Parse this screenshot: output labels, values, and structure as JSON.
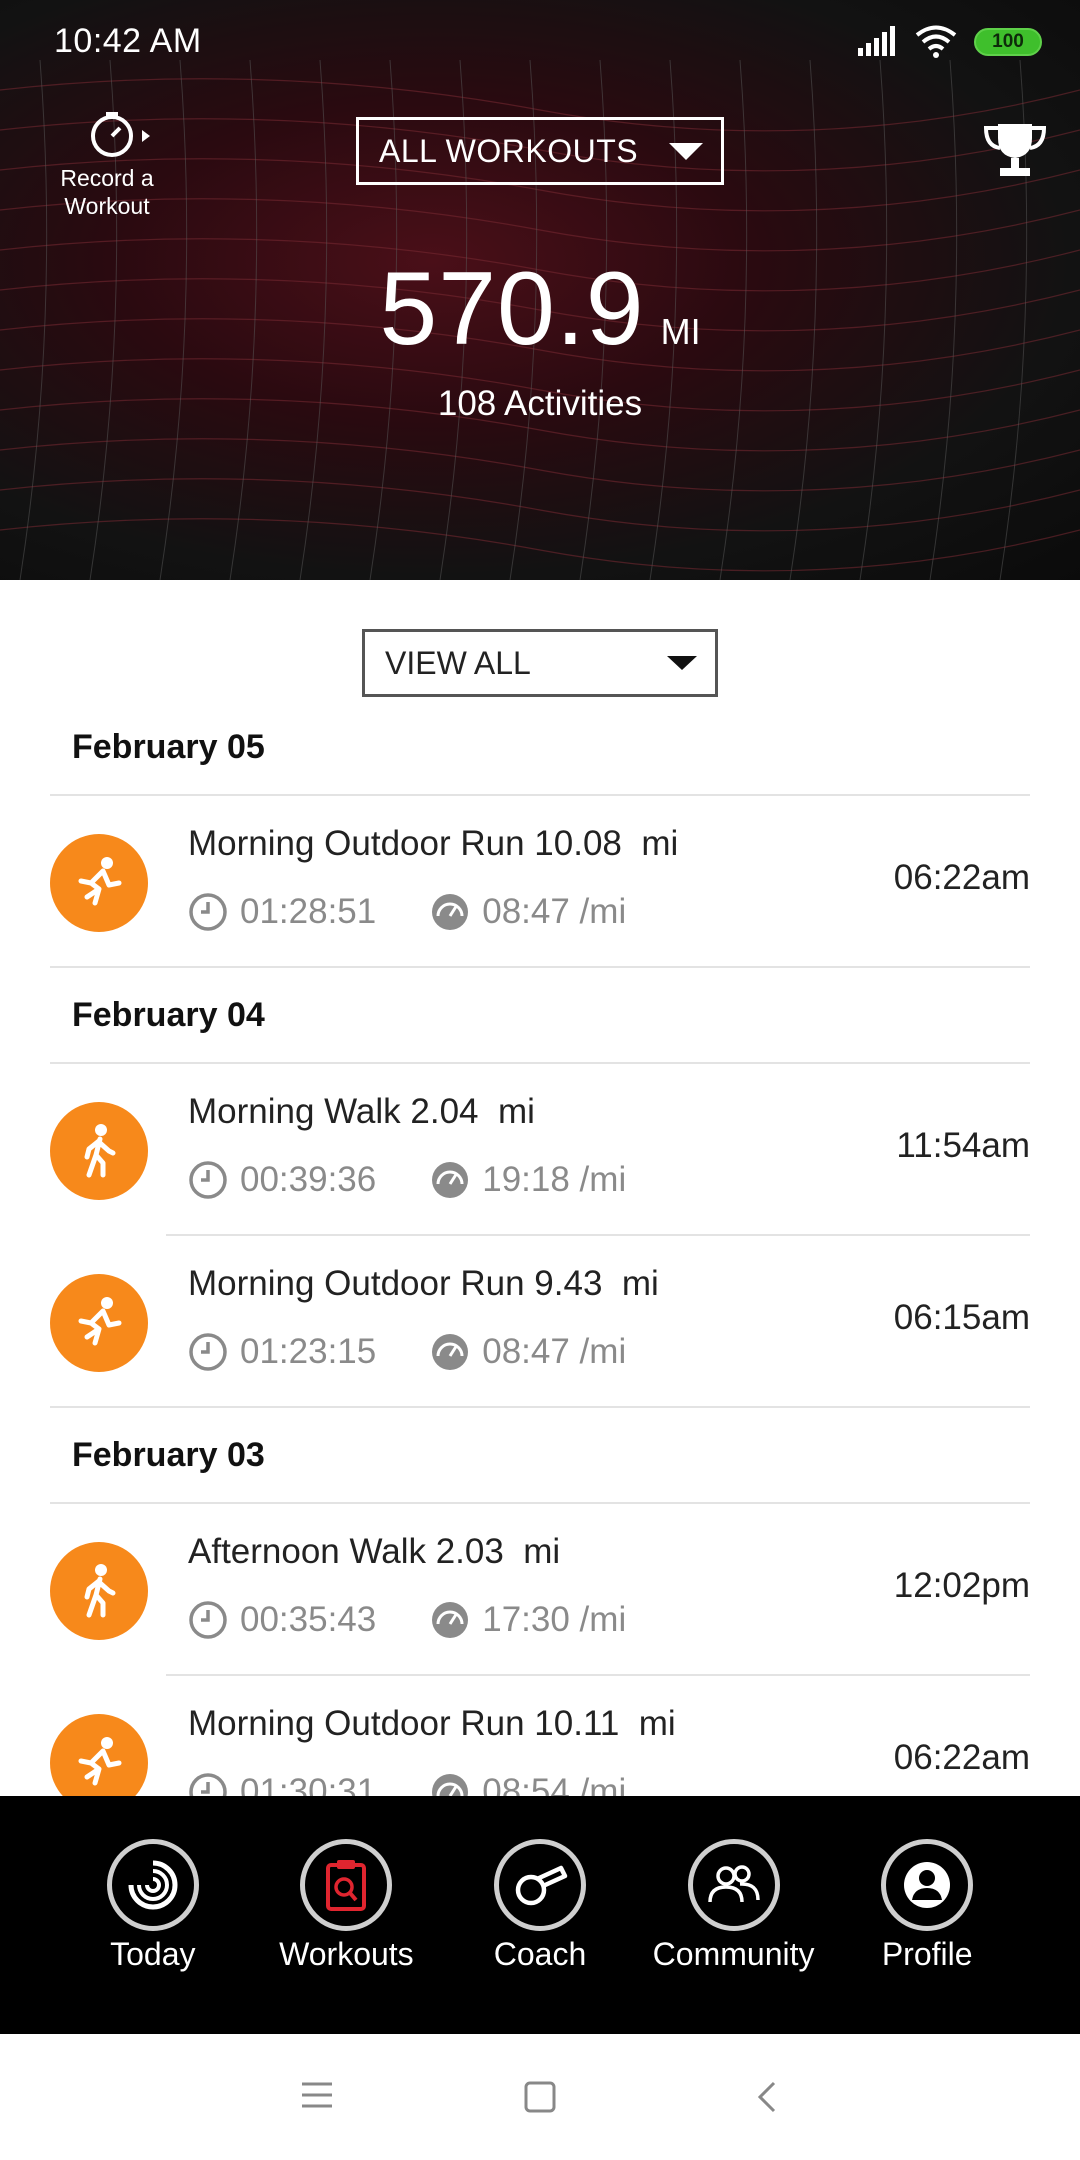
{
  "status_bar": {
    "time": "10:42 AM",
    "battery": "100"
  },
  "header": {
    "record_label_line1": "Record a",
    "record_label_line2": "Workout",
    "filter_label": "ALL WORKOUTS",
    "total_distance": "570.9",
    "total_unit": "MI",
    "activities": "108 Activities"
  },
  "list": {
    "view_filter": "VIEW ALL",
    "days": [
      {
        "date": "February 05",
        "workouts": [
          {
            "title": "Morning Outdoor Run 10.08  mi",
            "duration": "01:28:51",
            "pace": "08:47 /mi",
            "time": "06:22am",
            "icon": "run-icon"
          }
        ]
      },
      {
        "date": "February 04",
        "workouts": [
          {
            "title": "Morning Walk 2.04  mi",
            "duration": "00:39:36",
            "pace": "19:18 /mi",
            "time": "11:54am",
            "icon": "walk-icon"
          },
          {
            "title": "Morning Outdoor Run 9.43  mi",
            "duration": "01:23:15",
            "pace": "08:47 /mi",
            "time": "06:15am",
            "icon": "run-icon"
          }
        ]
      },
      {
        "date": "February 03",
        "workouts": [
          {
            "title": "Afternoon Walk 2.03  mi",
            "duration": "00:35:43",
            "pace": "17:30 /mi",
            "time": "12:02pm",
            "icon": "walk-icon"
          },
          {
            "title": "Morning Outdoor Run 10.11  mi",
            "duration": "01:30:31",
            "pace": "08:54 /mi",
            "time": "06:22am",
            "icon": "run-icon"
          }
        ]
      }
    ]
  },
  "nav": {
    "items": [
      {
        "label": "Today",
        "icon": "today-ring-icon"
      },
      {
        "label": "Workouts",
        "icon": "workouts-clipboard-icon",
        "active": true
      },
      {
        "label": "Coach",
        "icon": "whistle-icon"
      },
      {
        "label": "Community",
        "icon": "community-people-icon"
      },
      {
        "label": "Profile",
        "icon": "profile-user-icon"
      }
    ]
  },
  "colors": {
    "accent_orange": "#f7891b",
    "active_red": "#e0252f",
    "header_dark": "#121212"
  }
}
